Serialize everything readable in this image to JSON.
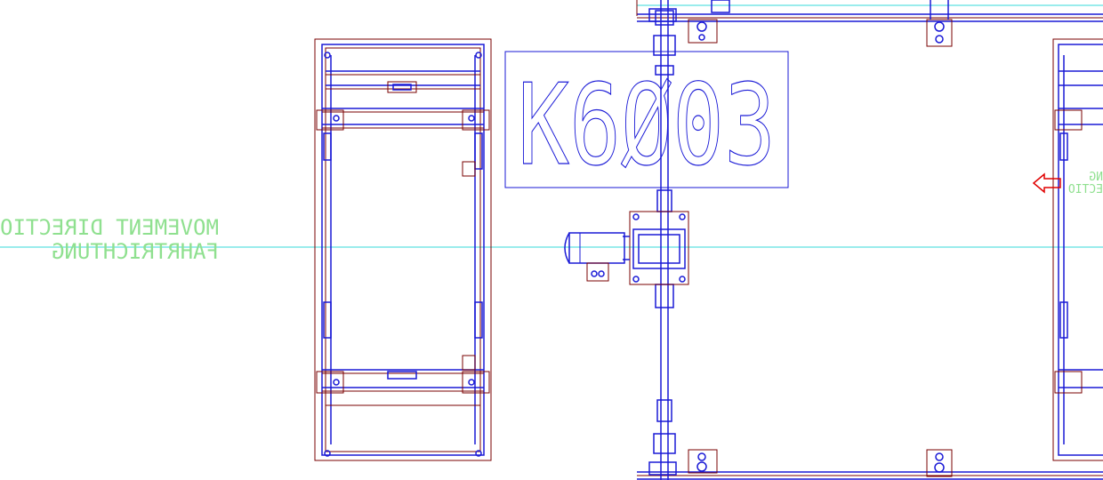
{
  "drawing": {
    "background": "#ffffff",
    "colors": {
      "frame": "#1a1ad6",
      "outline": "#7a0000",
      "centerline": "#35d9d9",
      "label": "#8fe08f",
      "arrow": "#e00000"
    }
  },
  "labels": {
    "station_code": "K6Ø03",
    "direction_en": "MOVEMENT DIRECTIO",
    "direction_de": "FAHRTRICHTUNG",
    "right_fragment_1": "NG",
    "right_fragment_2": "ECTIO"
  },
  "icons": {
    "arrow": "direction-arrow-icon",
    "motor": "gear-motor-icon"
  }
}
